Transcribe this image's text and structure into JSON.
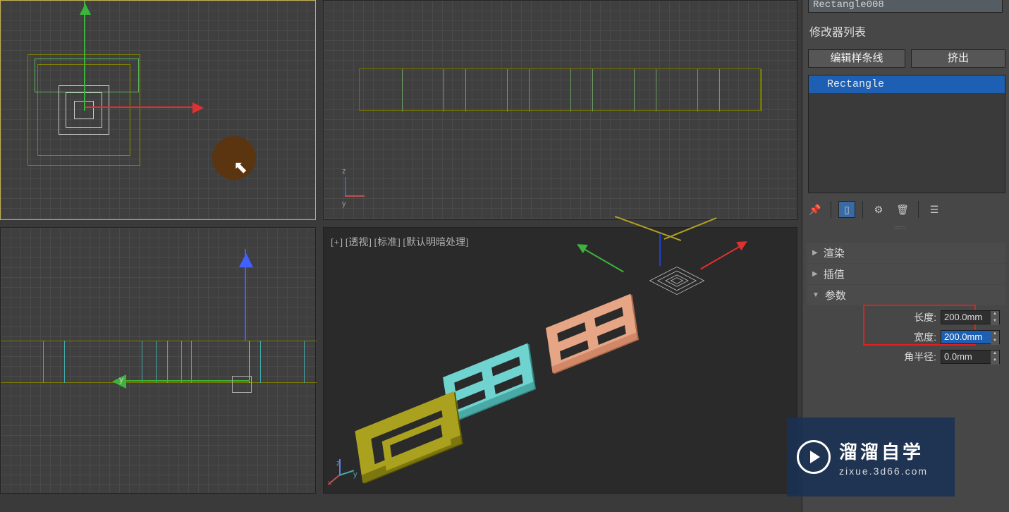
{
  "object_name": "Rectangle008",
  "modifier_list_label": "修改器列表",
  "dropdowns": {
    "edit_spline": "编辑样条线",
    "extrude": "挤出"
  },
  "modifier_stack": {
    "selected": "Rectangle"
  },
  "rollouts": {
    "rendering": "渲染",
    "interpolation": "插值",
    "parameters": "参数"
  },
  "parameters": {
    "length": {
      "label": "长度:",
      "value": "200.0mm"
    },
    "width": {
      "label": "宽度:",
      "value": "200.0mm"
    },
    "corner_radius": {
      "label": "角半径:",
      "value": "0.0mm"
    }
  },
  "viewports": {
    "perspective_label": "[+] [透视] [标准] [默认明暗处理]",
    "top": {
      "axes": {
        "x": "x",
        "y": "y"
      }
    },
    "front": {
      "axes": {
        "z": "z",
        "y": "y"
      }
    },
    "left": {
      "axes": {
        "y": "y"
      }
    },
    "persp_mini": {
      "x": "x",
      "y": "y",
      "z": "z"
    }
  },
  "watermark": {
    "title": "溜溜自学",
    "url": "zixue.3d66.com"
  },
  "icons": {
    "pin": "📌",
    "stack": "▯",
    "link": "⚙",
    "trash": "🗑",
    "config": "☰"
  }
}
